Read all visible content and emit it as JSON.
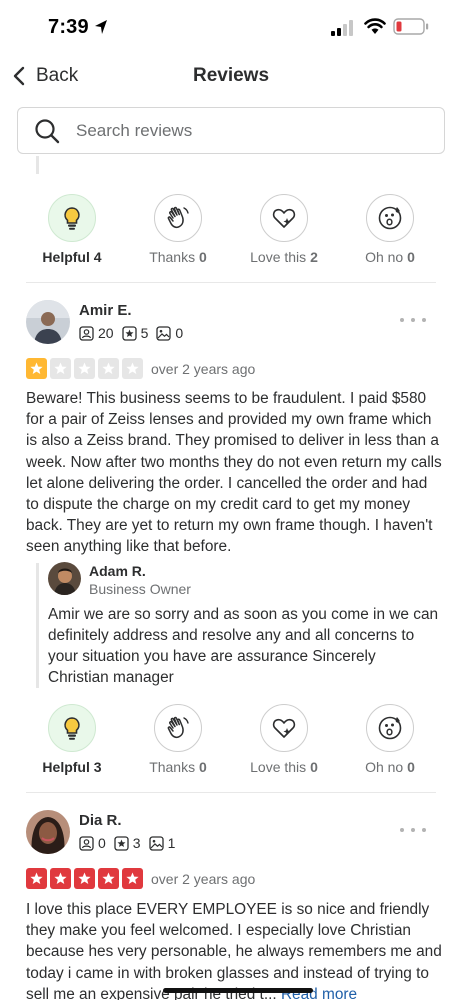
{
  "status_bar": {
    "time": "7:39"
  },
  "nav": {
    "back_label": "Back",
    "title": "Reviews"
  },
  "search": {
    "placeholder": "Search reviews"
  },
  "previous_review": {
    "clipped_text": "...",
    "reactions": [
      {
        "label": "Helpful",
        "count": "4",
        "active": true
      },
      {
        "label": "Thanks",
        "count": "0",
        "active": false
      },
      {
        "label": "Love this",
        "count": "2",
        "active": false
      },
      {
        "label": "Oh no",
        "count": "0",
        "active": false
      }
    ]
  },
  "reviews": [
    {
      "name": "Amir E.",
      "friends": "20",
      "reviews": "5",
      "photos": "0",
      "rating": 1,
      "date": "over 2 years ago",
      "text": "Beware! This business seems to be fraudulent. I paid $580 for a pair of Zeiss lenses and provided my own frame which is also a Zeiss brand. They promised to deliver in less than a week. Now after two months they do not even return my calls let alone delivering the order. I cancelled the order and had to dispute the charge on my credit card to get my money back. They are yet to return my own frame though. I haven't seen anything like that before.",
      "reply": {
        "name": "Adam R.",
        "role": "Business Owner",
        "text": "Amir we are so sorry and as soon as you come in we can definitely address and resolve any and all concerns to your situation you have are assurance Sincerely Christian manager"
      },
      "reactions": [
        {
          "label": "Helpful",
          "count": "3",
          "active": true
        },
        {
          "label": "Thanks",
          "count": "0",
          "active": false
        },
        {
          "label": "Love this",
          "count": "0",
          "active": false
        },
        {
          "label": "Oh no",
          "count": "0",
          "active": false
        }
      ]
    },
    {
      "name": "Dia R.",
      "friends": "0",
      "reviews": "3",
      "photos": "1",
      "rating": 5,
      "date": "over 2 years ago",
      "text": "I love this place EVERY EMPLOYEE is so nice and friendly they make you feel welcomed. I especially love Christian because hes very personable, he always remembers me and today i came in with broken glasses and instead of trying to sell me an expensive pair he tried t...",
      "read_more": "Read more"
    }
  ],
  "colors": {
    "star_one": "#ffb833",
    "star_five": "#e0393e",
    "star_empty": "#e6e6e6",
    "helpful_active_bg": "#e9f8ea",
    "link": "#1f5fa8"
  }
}
